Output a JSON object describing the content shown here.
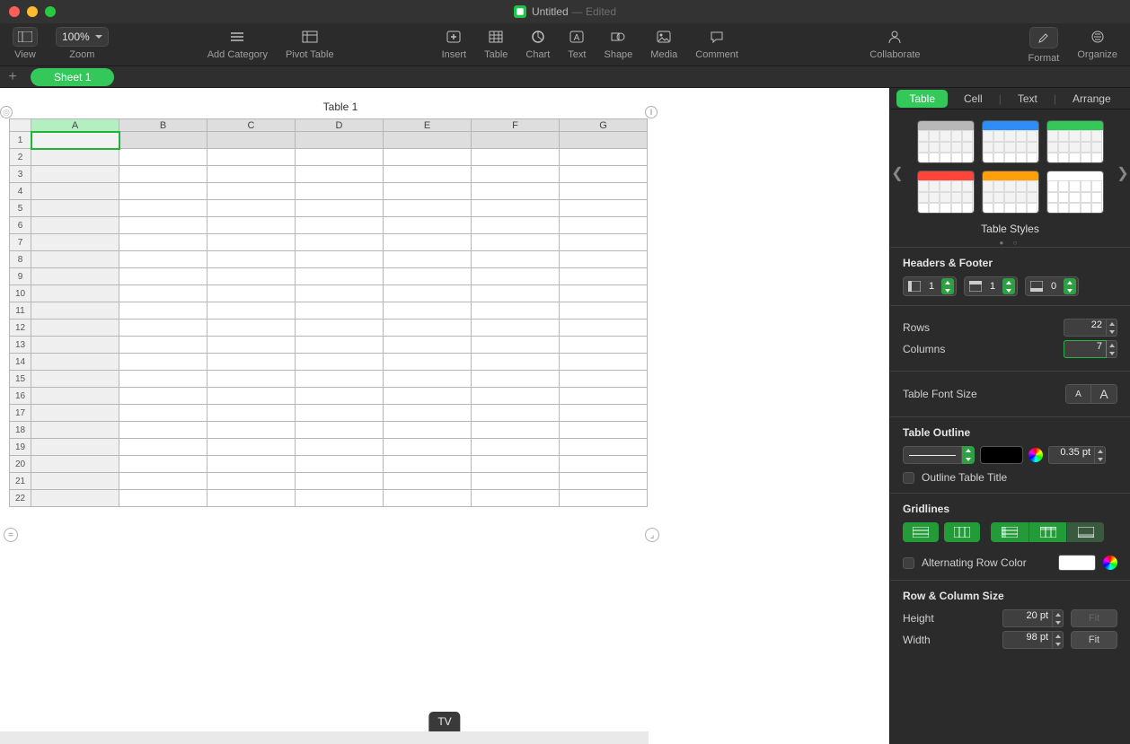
{
  "window": {
    "title": "Untitled",
    "edited_suffix": "— Edited"
  },
  "toolbar": {
    "view": "View",
    "zoom_value": "100%",
    "zoom_label": "Zoom",
    "add_category": "Add Category",
    "pivot_table": "Pivot Table",
    "insert": "Insert",
    "table": "Table",
    "chart": "Chart",
    "text": "Text",
    "shape": "Shape",
    "media": "Media",
    "comment": "Comment",
    "collaborate": "Collaborate",
    "format": "Format",
    "organize": "Organize"
  },
  "sheet_tab": "Sheet 1",
  "sheet": {
    "table_title": "Table 1",
    "columns": [
      "A",
      "B",
      "C",
      "D",
      "E",
      "F",
      "G"
    ],
    "rows": 22,
    "selected_col": "A",
    "selected_cell": {
      "row": 1,
      "col": "A"
    }
  },
  "tooltip": "TV",
  "inspector": {
    "tabs": {
      "table": "Table",
      "cell": "Cell",
      "text": "Text",
      "arrange": "Arrange"
    },
    "active_tab": "table",
    "styles_caption": "Table Styles",
    "headers_footer_title": "Headers & Footer",
    "header_cols": "1",
    "header_rows": "1",
    "footer_rows": "0",
    "rows_label": "Rows",
    "rows_value": "22",
    "columns_label": "Columns",
    "columns_value": "7",
    "font_size_label": "Table Font Size",
    "outline_title": "Table Outline",
    "outline_pt": "0.35 pt",
    "outline_check": "Outline Table Title",
    "gridlines_title": "Gridlines",
    "alt_row_label": "Alternating Row Color",
    "size_title": "Row & Column Size",
    "height_label": "Height",
    "height_value": "20 pt",
    "height_fit": "Fit",
    "width_label": "Width",
    "width_value": "98 pt",
    "width_fit": "Fit"
  },
  "style_thumb_colors": [
    "#b8b8b8",
    "#2e8df6",
    "#34c759",
    "#ff453a",
    "#ff9f0a",
    "#ffffff"
  ]
}
